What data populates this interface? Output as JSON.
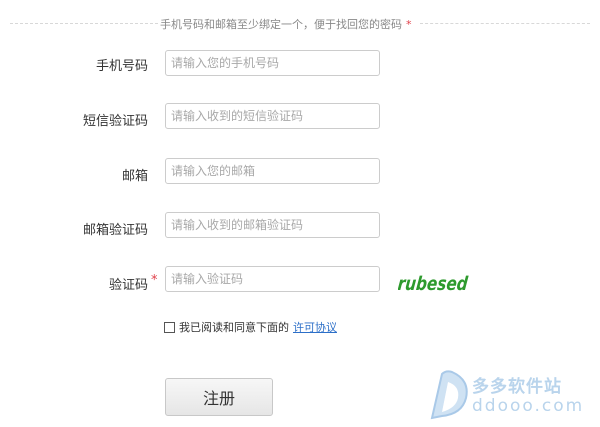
{
  "notice": {
    "text": "手机号码和邮箱至少绑定一个，便于找回您的密码",
    "required_mark": "*"
  },
  "form": {
    "phone": {
      "label": "手机号码",
      "placeholder": "请输入您的手机号码",
      "value": ""
    },
    "sms_code": {
      "label": "短信验证码",
      "placeholder": "请输入收到的短信验证码",
      "value": ""
    },
    "email": {
      "label": "邮箱",
      "placeholder": "请输入您的邮箱",
      "value": ""
    },
    "email_code": {
      "label": "邮箱验证码",
      "placeholder": "请输入收到的邮箱验证码",
      "value": ""
    },
    "captcha": {
      "label": "验证码",
      "required_mark": "*",
      "placeholder": "请输入验证码",
      "value": "",
      "image_text": "rubesed"
    }
  },
  "agreement": {
    "checked": false,
    "text": "我已阅读和同意下面的",
    "link_label": "许可协议"
  },
  "register_button": "注册",
  "watermark": {
    "title": "多多软件站",
    "url": "ddooo.com"
  },
  "colors": {
    "required": "#e0404a",
    "link": "#2c6fc8",
    "captcha_text": "#2e9a2e",
    "watermark": "#b9d4ec",
    "input_border": "#cccccc"
  }
}
